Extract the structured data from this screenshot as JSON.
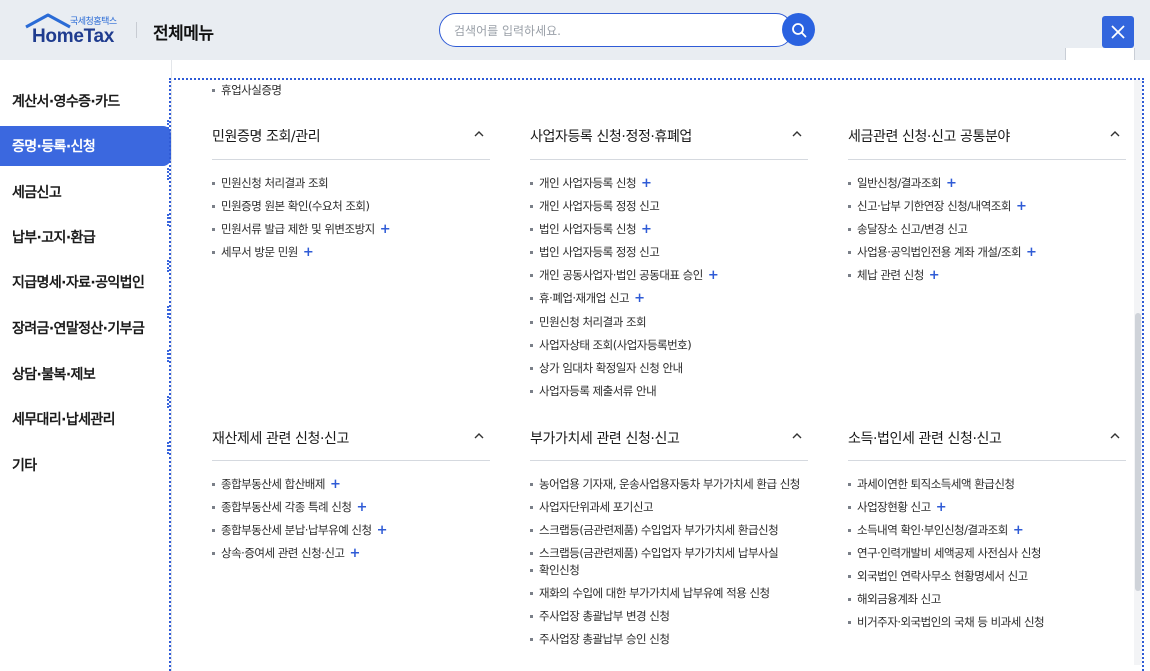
{
  "header": {
    "logo_sub": "국세청홈택스",
    "logo_main": "HomeTax",
    "title": "전체메뉴",
    "search_placeholder": "검색어를 입력하세요."
  },
  "sidebar": {
    "items": [
      {
        "label": "계산서·영수증·카드",
        "active": false
      },
      {
        "label": "증명·등록·신청",
        "active": true
      },
      {
        "label": "세금신고",
        "active": false
      },
      {
        "label": "납부·고지·환급",
        "active": false
      },
      {
        "label": "지급명세·자료·공익법인",
        "active": false
      },
      {
        "label": "장려금·연말정산·기부금",
        "active": false
      },
      {
        "label": "상담·불복·제보",
        "active": false
      },
      {
        "label": "세무대리·납세관리",
        "active": false
      },
      {
        "label": "기타",
        "active": false
      }
    ]
  },
  "top_fragment_item": "휴업사실증명",
  "sections": [
    {
      "title": "민원증명 조회/관리",
      "items": [
        {
          "label": "민원신청 처리결과 조회",
          "plus": false
        },
        {
          "label": "민원증명 원본 확인(수요처 조회)",
          "plus": false
        },
        {
          "label": "민원서류 발급 제한 및 위변조방지",
          "plus": true
        },
        {
          "label": "세무서 방문 민원",
          "plus": true
        }
      ]
    },
    {
      "title": "사업자등록 신청·정정·휴폐업",
      "items": [
        {
          "label": "개인 사업자등록 신청",
          "plus": true
        },
        {
          "label": "개인 사업자등록 정정 신고",
          "plus": false
        },
        {
          "label": "법인 사업자등록 신청",
          "plus": true
        },
        {
          "label": "법인 사업자등록 정정 신고",
          "plus": false
        },
        {
          "label": "개인 공동사업자·법인 공동대표 승인",
          "plus": true
        },
        {
          "label": "휴·폐업·재개업 신고",
          "plus": true
        },
        {
          "label": "민원신청 처리결과 조회",
          "plus": false
        },
        {
          "label": "사업자상태 조회(사업자등록번호)",
          "plus": false
        },
        {
          "label": "상가 임대차 확정일자 신청 안내",
          "plus": false
        },
        {
          "label": "사업자등록 제출서류 안내",
          "plus": false
        }
      ]
    },
    {
      "title": "세금관련 신청·신고 공통분야",
      "items": [
        {
          "label": "일반신청/결과조회",
          "plus": true
        },
        {
          "label": "신고·납부 기한연장 신청/내역조회",
          "plus": true
        },
        {
          "label": "송달장소 신고/변경 신고",
          "plus": false
        },
        {
          "label": "사업용·공익법인전용 계좌 개설/조회",
          "plus": true
        },
        {
          "label": "체납 관련 신청",
          "plus": true
        }
      ]
    },
    {
      "title": "재산제세 관련 신청·신고",
      "items": [
        {
          "label": "종합부동산세 합산배제",
          "plus": true
        },
        {
          "label": "종합부동산세 각종 특례 신청",
          "plus": true
        },
        {
          "label": "종합부동산세 분납·납부유예 신청",
          "plus": true
        },
        {
          "label": "상속·증여세 관련 신청·신고",
          "plus": true
        }
      ]
    },
    {
      "title": "부가가치세 관련 신청·신고",
      "items": [
        {
          "label": "농어업용 기자재, 운송사업용자동차 부가가치세 환급 신청",
          "plus": false
        },
        {
          "label": "사업자단위과세 포기신고",
          "plus": false
        },
        {
          "label": "스크랩등(금관련제품) 수입업자 부가가치세 환급신청",
          "plus": false
        },
        {
          "label": "스크랩등(금관련제품) 수입업자 부가가치세 납부사실",
          "plus": false,
          "line2": "확인신청"
        },
        {
          "label": "재화의 수입에 대한 부가가치세 납부유예 적용 신청",
          "plus": false
        },
        {
          "label": "주사업장 총괄납부 변경 신청",
          "plus": false
        },
        {
          "label": "주사업장 총괄납부 승인 신청",
          "plus": false
        }
      ]
    },
    {
      "title": "소득·법인세 관련 신청·신고",
      "items": [
        {
          "label": "과세이연한 퇴직소득세액 환급신청",
          "plus": false
        },
        {
          "label": "사업장현황 신고",
          "plus": true
        },
        {
          "label": "소득내역 확인·부인신청/결과조회",
          "plus": true
        },
        {
          "label": "연구·인력개발비 세액공제 사전심사 신청",
          "plus": false
        },
        {
          "label": "외국법인 연락사무소 현황명세서 신고",
          "plus": false
        },
        {
          "label": "해외금융계좌 신고",
          "plus": false
        },
        {
          "label": "비거주자·외국법인의 국채 등 비과세 신청",
          "plus": false
        }
      ]
    }
  ]
}
